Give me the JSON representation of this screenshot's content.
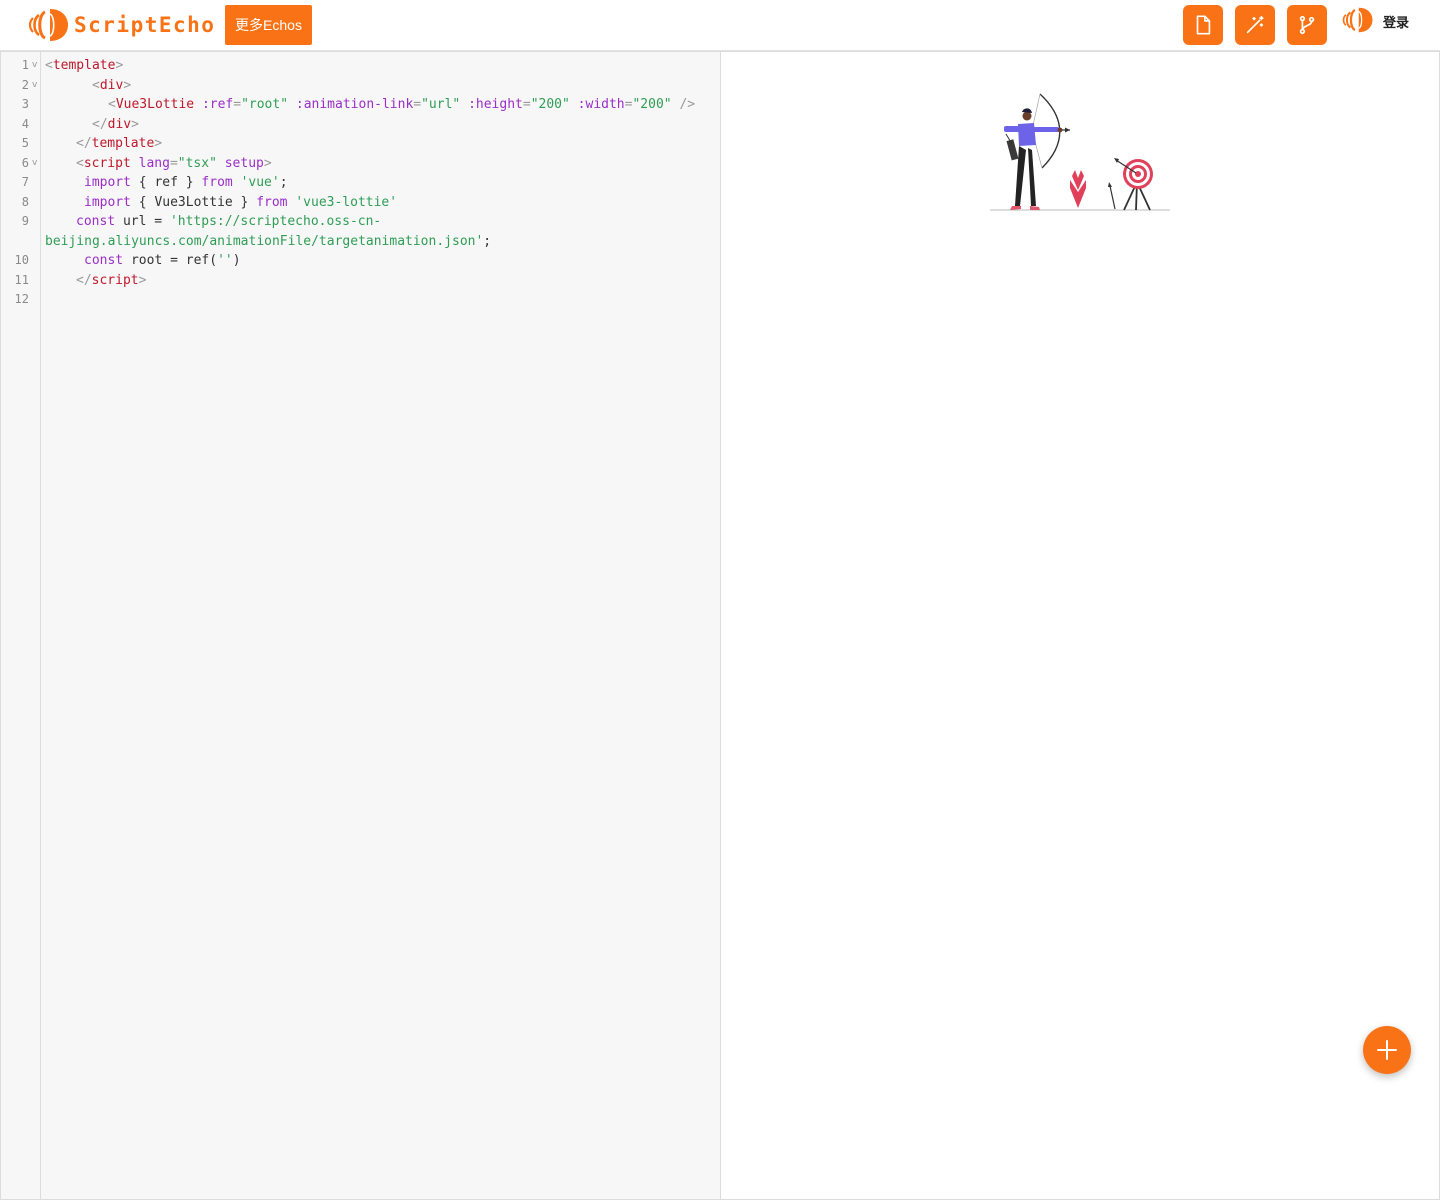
{
  "header": {
    "brand": "ScriptEcho",
    "more_echos_label": "更多Echos",
    "login_label": "登录"
  },
  "icons": {
    "new_file": "file-icon",
    "magic": "magic-wand-icon",
    "fork": "git-branch-icon",
    "fab": "plus-icon"
  },
  "colors": {
    "accent": "#f97316",
    "tag": "#c0182b",
    "attr": "#9b2ec9",
    "string": "#2f9e55"
  },
  "editor": {
    "line_numbers": [
      "1",
      "2",
      "3",
      "4",
      "5",
      "6",
      "7",
      "8",
      "9",
      "10",
      "11",
      "12"
    ],
    "code": {
      "l1": {
        "lt": "<",
        "tag": "template",
        "gt": ">"
      },
      "l2": {
        "lt": "<",
        "tag": "div",
        "gt": ">"
      },
      "l3": {
        "lt": "<",
        "tag": "Vue3Lottie",
        "attr1": ":ref",
        "eq1": "=",
        "val1": "\"root\"",
        "attr2": ":animation-link",
        "eq2": "=",
        "val2": "\"url\"",
        "attr3": ":height",
        "eq3": "=",
        "val3": "\"200\"",
        "attr4": ":width",
        "eq4": "=",
        "val4": "\"200\"",
        "close": "/>"
      },
      "l4": {
        "lt": "</",
        "tag": "div",
        "gt": ">"
      },
      "l5": {
        "lt": "</",
        "tag": "template",
        "gt": ">"
      },
      "l6": {
        "lt": "<",
        "tag": "script",
        "attr1": "lang",
        "eq1": "=",
        "val1": "\"tsx\"",
        "attr2": "setup",
        "gt": ">"
      },
      "l7": {
        "kw1": "import",
        "body": "{ ref }",
        "kw2": "from",
        "str": "'vue'",
        "end": ";"
      },
      "l8": {
        "kw1": "import",
        "body": "{ Vue3Lottie }",
        "kw2": "from",
        "str": "'vue3-lottie'"
      },
      "l9": {
        "kw": "const",
        "body": "url =",
        "str_a": "'https://scriptecho.oss-cn-"
      },
      "l9b": {
        "str_b": "beijing.aliyuncs.com/animationFile/targetanimation.json'",
        "end": ";"
      },
      "l10": {
        "kw": "const",
        "body": "root = ref(",
        "str": "''",
        "end": ")"
      },
      "l11": {
        "lt": "</",
        "tag": "script",
        "gt": ">"
      }
    }
  }
}
